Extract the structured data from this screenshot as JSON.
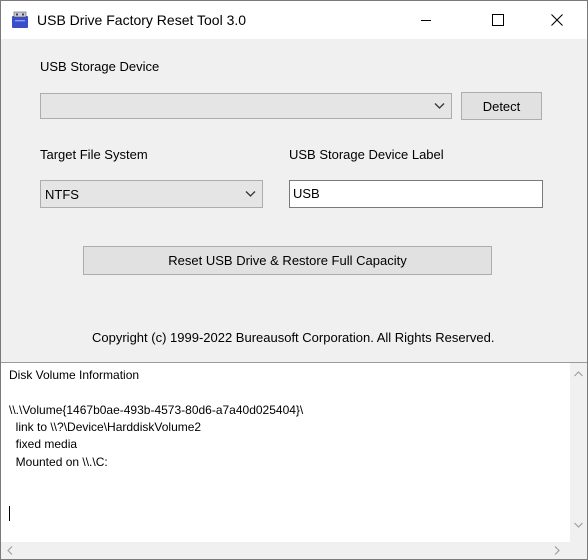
{
  "window": {
    "title": "USB Drive Factory Reset Tool 3.0"
  },
  "device": {
    "label": "USB Storage Device",
    "selected": "",
    "detect_label": "Detect"
  },
  "filesystem": {
    "label": "Target File System",
    "selected": "NTFS"
  },
  "volume_label": {
    "label": "USB Storage Device Label",
    "value": "USB"
  },
  "reset_button_label": "Reset USB Drive & Restore Full Capacity",
  "copyright": "Copyright (c) 1999-2022 Bureausoft Corporation. All Rights Reserved.",
  "info": {
    "heading": "Disk Volume Information",
    "lines": [
      "\\\\.\\Volume{1467b0ae-493b-4573-80d6-a7a40d025404}\\",
      "  link to \\\\?\\Device\\HarddiskVolume2",
      "  fixed media",
      "  Mounted on \\\\.\\C:"
    ]
  },
  "icons": {
    "app": "usb-drive-icon",
    "minimize": "minimize-icon",
    "maximize": "maximize-icon",
    "close": "close-icon"
  },
  "colors": {
    "window_bg": "#f0f0f0",
    "button_bg": "#e1e1e1",
    "border": "#adadad"
  }
}
